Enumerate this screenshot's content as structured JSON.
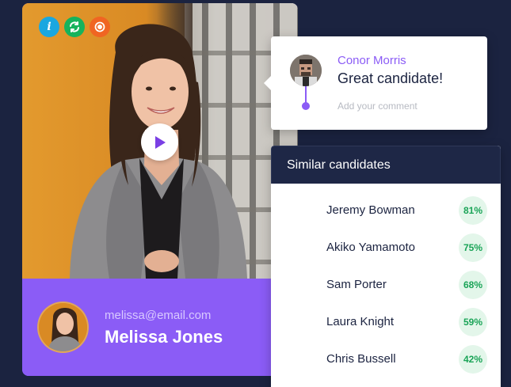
{
  "video": {
    "status_icons": [
      {
        "name": "info-icon",
        "glyph": "i",
        "color": "#1aa7e0"
      },
      {
        "name": "sync-icon",
        "glyph": "⟳",
        "color": "#16b35c"
      },
      {
        "name": "record-icon",
        "glyph": "◉",
        "color": "#f06522"
      }
    ],
    "play_icon": "play-icon"
  },
  "profile": {
    "email": "melissa@email.com",
    "name": "Melissa Jones"
  },
  "comment": {
    "author": "Conor Morris",
    "text": "Great candidate!",
    "placeholder": "Add your comment"
  },
  "similar": {
    "title": "Similar candidates",
    "candidates": [
      {
        "name": "Jeremy Bowman",
        "match": "81%"
      },
      {
        "name": "Akiko Yamamoto",
        "match": "75%"
      },
      {
        "name": "Sam Porter",
        "match": "68%"
      },
      {
        "name": "Laura Knight",
        "match": "59%"
      },
      {
        "name": "Chris Bussell",
        "match": "42%"
      }
    ]
  },
  "colors": {
    "background": "#1b2340",
    "accent": "#8b5cf6",
    "match_green": "#1aa457",
    "match_bg": "#e3f6ea"
  }
}
